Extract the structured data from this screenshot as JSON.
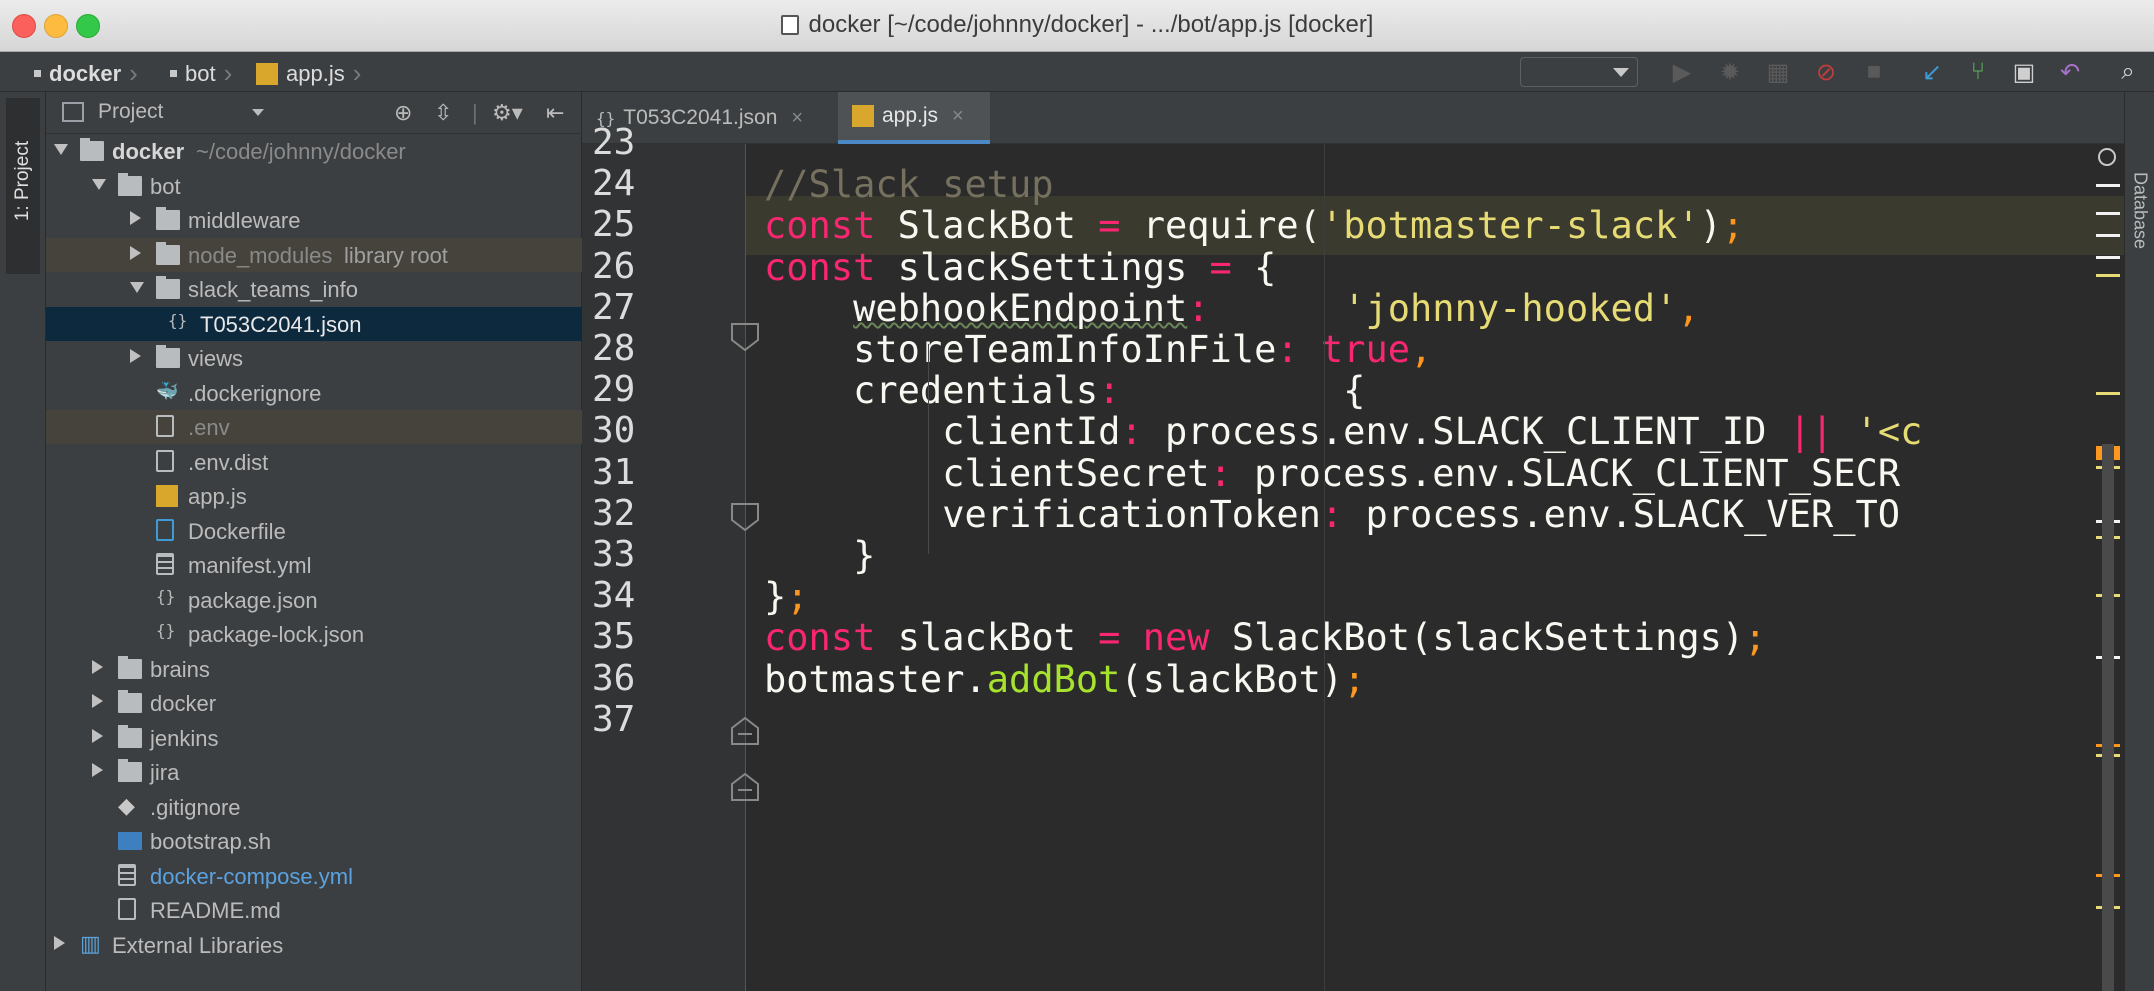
{
  "window": {
    "title": "docker [~/code/johnny/docker] - .../bot/app.js [docker]"
  },
  "colors": {
    "keyword": "#f92672",
    "string": "#e6db74",
    "comment": "#75715e",
    "function": "#a6e22e",
    "punctuation": "#fd971f",
    "selection": "#0d293e"
  },
  "navbar": {
    "crumbs": [
      "docker",
      "bot",
      "app.js"
    ]
  },
  "toolbar": {
    "icons": [
      "run-icon",
      "debug-icon",
      "coverage-icon",
      "stop-build-icon",
      "stop-icon",
      "vcs-update-icon",
      "vcs-commit-icon",
      "history-icon",
      "revert-icon",
      "search-icon"
    ]
  },
  "left_strip": {
    "project_label": "1: Project"
  },
  "right_strip": {
    "database_label": "Database"
  },
  "project": {
    "header_title": "Project",
    "tree": [
      {
        "label": "docker",
        "extra": "~/code/johnny/docker",
        "depth": 0,
        "type": "folder",
        "arrow": "open"
      },
      {
        "label": "bot",
        "depth": 1,
        "type": "folder",
        "arrow": "open"
      },
      {
        "label": "middleware",
        "depth": 2,
        "type": "folder",
        "arrow": "closed"
      },
      {
        "label": "node_modules",
        "extra": "library root",
        "depth": 2,
        "type": "folder",
        "arrow": "closed",
        "dim": true
      },
      {
        "label": "slack_teams_info",
        "depth": 2,
        "type": "folder",
        "arrow": "open"
      },
      {
        "label": "T053C2041.json",
        "depth": 3,
        "type": "json",
        "selected": true
      },
      {
        "label": "views",
        "depth": 2,
        "type": "folder",
        "arrow": "closed"
      },
      {
        "label": ".dockerignore",
        "depth": 2,
        "type": "docker"
      },
      {
        "label": ".env",
        "depth": 2,
        "type": "file",
        "dim": true
      },
      {
        "label": ".env.dist",
        "depth": 2,
        "type": "file"
      },
      {
        "label": "app.js",
        "depth": 2,
        "type": "js"
      },
      {
        "label": "Dockerfile",
        "depth": 2,
        "type": "dockerfile"
      },
      {
        "label": "manifest.yml",
        "depth": 2,
        "type": "yml"
      },
      {
        "label": "package.json",
        "depth": 2,
        "type": "json"
      },
      {
        "label": "package-lock.json",
        "depth": 2,
        "type": "json"
      },
      {
        "label": "brains",
        "depth": 1,
        "type": "folder",
        "arrow": "closed"
      },
      {
        "label": "docker",
        "depth": 1,
        "type": "folder",
        "arrow": "closed"
      },
      {
        "label": "jenkins",
        "depth": 1,
        "type": "folder",
        "arrow": "closed"
      },
      {
        "label": "jira",
        "depth": 1,
        "type": "folder",
        "arrow": "closed"
      },
      {
        "label": ".gitignore",
        "depth": 1,
        "type": "git"
      },
      {
        "label": "bootstrap.sh",
        "depth": 1,
        "type": "sh"
      },
      {
        "label": "docker-compose.yml",
        "depth": 1,
        "type": "yml",
        "blue": true
      },
      {
        "label": "README.md",
        "depth": 1,
        "type": "md"
      },
      {
        "label": "External Libraries",
        "depth": 0,
        "type": "libs",
        "arrow": "closed"
      }
    ]
  },
  "tabs": [
    {
      "label": "T053C2041.json",
      "active": false
    },
    {
      "label": "app.js",
      "active": true
    }
  ],
  "editor": {
    "line_numbers": [
      "23",
      "24",
      "25",
      "26",
      "27",
      "28",
      "29",
      "30",
      "31",
      "32",
      "33",
      "34",
      "35",
      "36",
      "37"
    ],
    "lines": [
      [],
      [
        [
          "cm",
          "//Slack setup"
        ]
      ],
      [
        [
          "kw",
          "const"
        ],
        [
          "t",
          " SlackBot "
        ],
        [
          "kw",
          "="
        ],
        [
          "t",
          " require("
        ],
        [
          "str",
          "'botmaster-slack'"
        ],
        [
          "t",
          ")"
        ],
        [
          "pn",
          ";"
        ]
      ],
      [
        [
          "kw",
          "const"
        ],
        [
          "t",
          " slackSettings "
        ],
        [
          "kw",
          "="
        ],
        [
          "t",
          " {"
        ]
      ],
      [
        [
          "t",
          "    "
        ],
        [
          "wv",
          "webhookEndpoint"
        ],
        [
          "kw",
          ":"
        ],
        [
          "t",
          "      "
        ],
        [
          "str",
          "'johnny-hooked'"
        ],
        [
          "pn",
          ","
        ]
      ],
      [
        [
          "t",
          "    storeTeamInfoInFile"
        ],
        [
          "kw",
          ":"
        ],
        [
          "t",
          " "
        ],
        [
          "kw",
          "true"
        ],
        [
          "pn",
          ","
        ]
      ],
      [
        [
          "t",
          "    credentials"
        ],
        [
          "kw",
          ":"
        ],
        [
          "t",
          "          {"
        ]
      ],
      [
        [
          "t",
          "        clientId"
        ],
        [
          "kw",
          ":"
        ],
        [
          "t",
          " process.env.SLACK_CLIENT_ID "
        ],
        [
          "kw",
          "||"
        ],
        [
          "t",
          " "
        ],
        [
          "str",
          "'<c"
        ]
      ],
      [
        [
          "t",
          "        clientSecret"
        ],
        [
          "kw",
          ":"
        ],
        [
          "t",
          " process.env.SLACK_CLIENT_SECR"
        ]
      ],
      [
        [
          "t",
          "        verificationToken"
        ],
        [
          "kw",
          ":"
        ],
        [
          "t",
          " process.env.SLACK_VER_TO"
        ]
      ],
      [
        [
          "t",
          "    }"
        ]
      ],
      [
        [
          "t",
          "}"
        ],
        [
          "pn",
          ";"
        ]
      ],
      [
        [
          "kw",
          "const"
        ],
        [
          "t",
          " slackBot "
        ],
        [
          "kw",
          "="
        ],
        [
          "t",
          " "
        ],
        [
          "kw",
          "new"
        ],
        [
          "t",
          " SlackBot(slackSettings)"
        ],
        [
          "pn",
          ";"
        ]
      ],
      [
        [
          "t",
          "botmaster."
        ],
        [
          "fn",
          "addBot"
        ],
        [
          "t",
          "(slackBot)"
        ],
        [
          "pn",
          ";"
        ]
      ],
      []
    ]
  }
}
